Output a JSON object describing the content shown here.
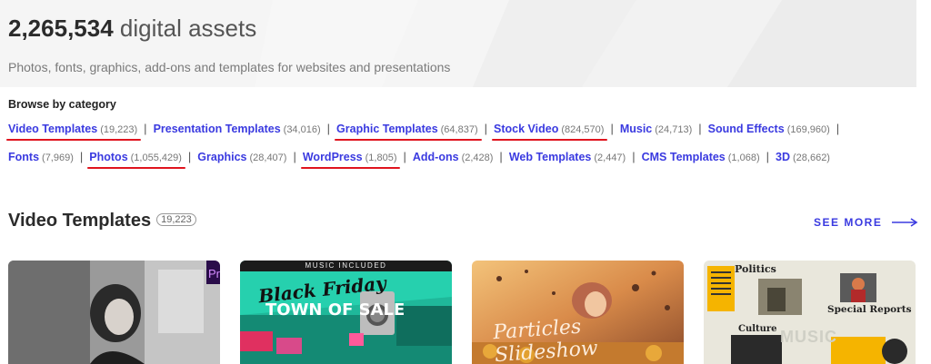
{
  "hero": {
    "asset_count": "2,265,534",
    "asset_label": "digital assets",
    "subtitle": "Photos, fonts, graphics, add-ons and templates for websites and presentations"
  },
  "browse": {
    "heading": "Browse by category",
    "row1": [
      {
        "label": "Video Templates",
        "count": "(19,223)",
        "marked": true
      },
      {
        "label": "Presentation Templates",
        "count": "(34,016)",
        "marked": false
      },
      {
        "label": "Graphic Templates",
        "count": "(64,837)",
        "marked": true
      },
      {
        "label": "Stock Video",
        "count": "(824,570)",
        "marked": true
      },
      {
        "label": "Music",
        "count": "(24,713)",
        "marked": false
      },
      {
        "label": "Sound Effects",
        "count": "(169,960)",
        "marked": false
      }
    ],
    "row2": [
      {
        "label": "Fonts",
        "count": "(7,969)",
        "marked": false
      },
      {
        "label": "Photos",
        "count": "(1,055,429)",
        "marked": true
      },
      {
        "label": "Graphics",
        "count": "(28,407)",
        "marked": false
      },
      {
        "label": "WordPress",
        "count": "(1,805)",
        "marked": true
      },
      {
        "label": "Add-ons",
        "count": "(2,428)",
        "marked": false
      },
      {
        "label": "Web Templates",
        "count": "(2,447)",
        "marked": false
      },
      {
        "label": "CMS Templates",
        "count": "(1,068)",
        "marked": false
      },
      {
        "label": "3D",
        "count": "(28,662)",
        "marked": false
      }
    ],
    "separator": "|"
  },
  "section": {
    "title": "Video Templates",
    "count": "19,223",
    "see_more": "SEE MORE"
  },
  "cards": {
    "card1": {
      "badge": "Pr"
    },
    "card2": {
      "banner": "MUSIC INCLUDED",
      "line1": "Black Friday",
      "line2": "TOWN OF SALE",
      "line3": "Black Friday",
      "sale_tag": "SALE"
    },
    "card3": {
      "title": "Particles Slideshow"
    },
    "card4": {
      "politics": "Politics",
      "special": "Special Reports",
      "culture": "Culture",
      "music": "MUSIC"
    }
  },
  "colors": {
    "link": "#3a3ae0",
    "underline_mark": "#e0141e",
    "hero_bg": "#f5f5f5"
  }
}
